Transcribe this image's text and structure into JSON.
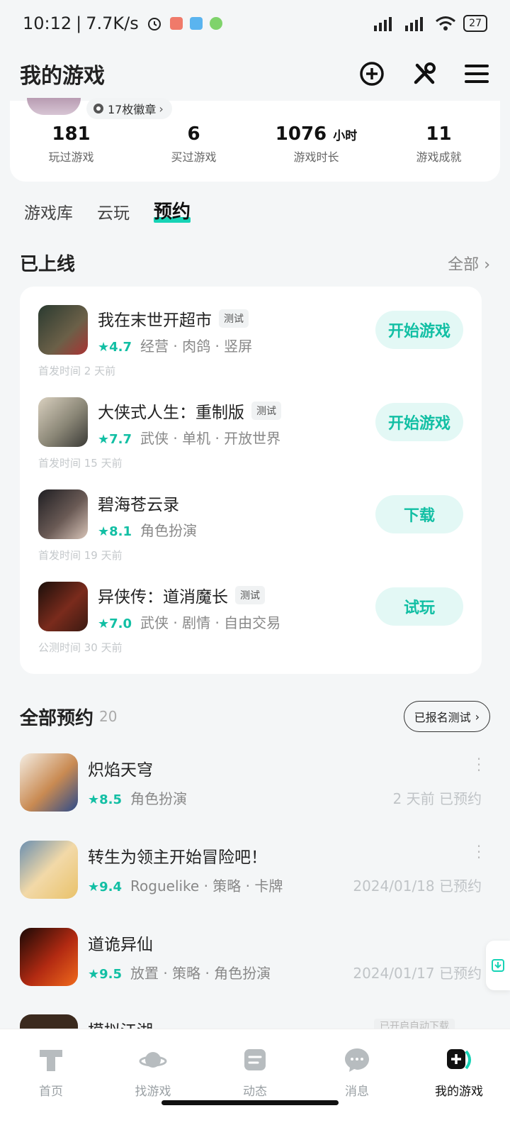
{
  "status_bar": {
    "time": "10:12",
    "net_speed": "7.7K/s",
    "battery": "27"
  },
  "header": {
    "title": "我的游戏"
  },
  "profile": {
    "badges": "17枚徽章",
    "stats": [
      {
        "value": "181",
        "unit": "",
        "label": "玩过游戏"
      },
      {
        "value": "6",
        "unit": "",
        "label": "买过游戏"
      },
      {
        "value": "1076",
        "unit": "小时",
        "label": "游戏时长"
      },
      {
        "value": "11",
        "unit": "",
        "label": "游戏成就"
      }
    ]
  },
  "tabs": [
    "游戏库",
    "云玩",
    "预约"
  ],
  "online": {
    "title": "已上线",
    "more": "全部",
    "games": [
      {
        "name": "我在末世开超市",
        "tag": "测试",
        "score": "4.7",
        "genres": "经营 · 肉鸽 · 竖屏",
        "time": "首发时间 2 天前",
        "action": "开始游戏"
      },
      {
        "name": "大侠式人生：重制版",
        "tag": "测试",
        "score": "7.7",
        "genres": "武侠 · 单机 · 开放世界",
        "time": "首发时间 15 天前",
        "action": "开始游戏"
      },
      {
        "name": "碧海苍云录",
        "tag": "",
        "score": "8.1",
        "genres": "角色扮演",
        "time": "首发时间 19 天前",
        "action": "下载"
      },
      {
        "name": "异侠传：道消魔长",
        "tag": "测试",
        "score": "7.0",
        "genres": "武侠 · 剧情 · 自由交易",
        "time": "公测时间 30 天前",
        "action": "试玩"
      }
    ]
  },
  "reservations": {
    "title": "全部预约",
    "count": "20",
    "filter": "已报名测试",
    "items": [
      {
        "name": "炽焰天穹",
        "score": "8.5",
        "genres": "角色扮演",
        "date": "2 天前 已预约"
      },
      {
        "name": "转生为领主开始冒险吧！",
        "score": "9.4",
        "genres": "Roguelike · 策略 · 卡牌",
        "date": "2024/01/18 已预约"
      },
      {
        "name": "道诡异仙",
        "score": "9.5",
        "genres": "放置 · 策略 · 角色扮演",
        "date": "2024/01/17 已预约"
      },
      {
        "name": "模拟江湖",
        "chip": "已开启自动下载"
      }
    ]
  },
  "bottom_nav": [
    {
      "label": "首页"
    },
    {
      "label": "找游戏"
    },
    {
      "label": "动态"
    },
    {
      "label": "消息"
    },
    {
      "label": "我的游戏"
    }
  ],
  "colors": {
    "accent": "#12bfa4",
    "accent_bg": "#e3f8f5",
    "tab_underline": "#17d3b6"
  }
}
